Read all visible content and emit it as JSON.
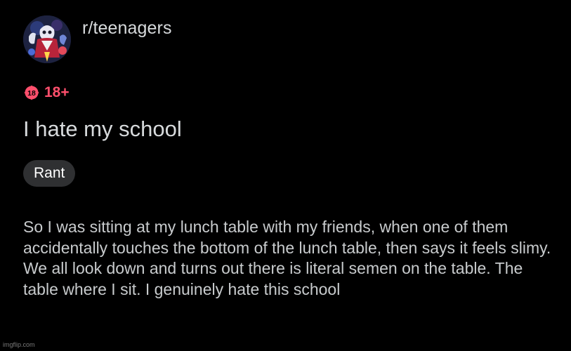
{
  "header": {
    "subreddit": "r/teenagers",
    "avatar_icon": "subreddit-avatar-icon"
  },
  "nsfw": {
    "icon": "nsfw-18-icon",
    "icon_text": "18",
    "label": "18+",
    "color": "#ff4f6c"
  },
  "post": {
    "title": "I hate my school",
    "flair": "Rant",
    "body": "So I was sitting at my lunch table with my friends, when one of them accidentally touches the bottom of the lunch table, then says it feels slimy. We all look down and turns out there is literal semen on the table. The table where I sit. I genuinely hate this school"
  },
  "watermark": "imgflip.com",
  "colors": {
    "background": "#000000",
    "text": "#d7dadc",
    "flair_bg": "#2f3032"
  }
}
